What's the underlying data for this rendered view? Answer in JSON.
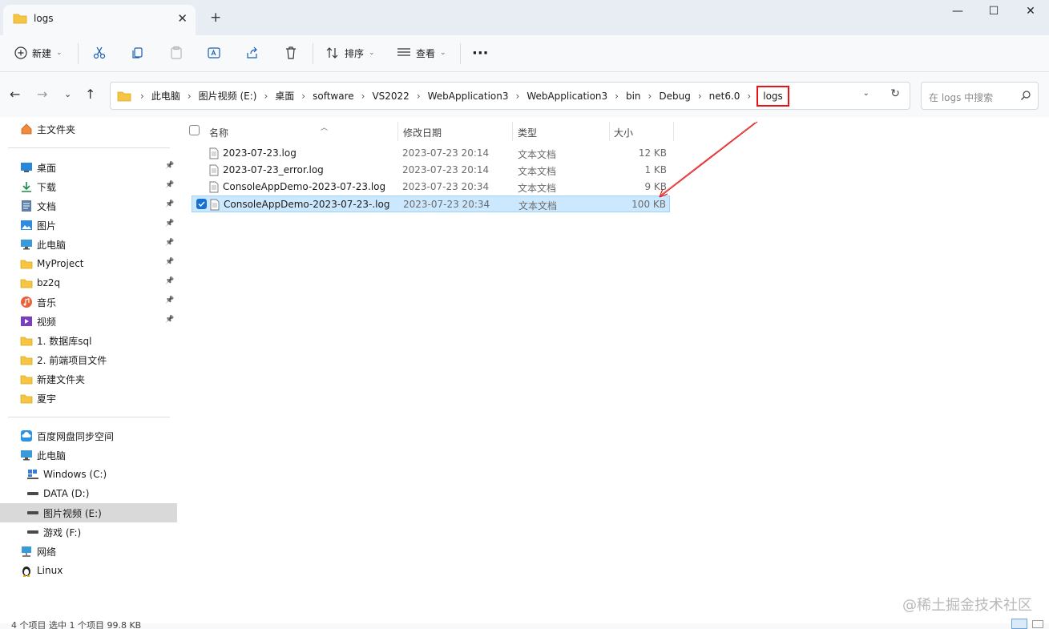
{
  "window": {
    "tab_title": "logs",
    "tab_close": "✕",
    "new_tab": "+",
    "minimize": "—",
    "maximize": "☐",
    "close": "✕"
  },
  "toolbar": {
    "new_label": "新建",
    "sort_label": "排序",
    "view_label": "查看",
    "more": "···"
  },
  "address": {
    "crumbs": [
      "此电脑",
      "图片视频 (E:)",
      "桌面",
      "software",
      "VS2022",
      "WebApplication3",
      "WebApplication3",
      "bin",
      "Debug",
      "net6.0"
    ],
    "current": "logs",
    "search_placeholder": "在 logs 中搜索"
  },
  "sidebar": {
    "home": "主文件夹",
    "quick": [
      {
        "label": "桌面",
        "icon": "desktop-icon",
        "pinned": true
      },
      {
        "label": "下载",
        "icon": "download-icon",
        "pinned": true
      },
      {
        "label": "文档",
        "icon": "document-icon",
        "pinned": true
      },
      {
        "label": "图片",
        "icon": "picture-icon",
        "pinned": true
      },
      {
        "label": "此电脑",
        "icon": "computer-icon",
        "pinned": true
      },
      {
        "label": "MyProject",
        "icon": "folder-icon",
        "pinned": true
      },
      {
        "label": "bz2q",
        "icon": "folder-icon",
        "pinned": true
      },
      {
        "label": "音乐",
        "icon": "music-icon",
        "pinned": true
      },
      {
        "label": "视频",
        "icon": "video-icon",
        "pinned": true
      },
      {
        "label": "1. 数据库sql",
        "icon": "folder-icon",
        "pinned": false
      },
      {
        "label": "2. 前端项目文件",
        "icon": "folder-icon",
        "pinned": false
      },
      {
        "label": "新建文件夹",
        "icon": "folder-icon",
        "pinned": false
      },
      {
        "label": "夏宇",
        "icon": "folder-icon",
        "pinned": false
      }
    ],
    "devices": [
      {
        "label": "百度网盘同步空间",
        "icon": "cloud-icon"
      },
      {
        "label": "此电脑",
        "icon": "computer-icon"
      },
      {
        "label": "Windows (C:)",
        "icon": "windows-drive-icon"
      },
      {
        "label": "DATA (D:)",
        "icon": "drive-icon"
      },
      {
        "label": "图片视频 (E:)",
        "icon": "drive-icon"
      },
      {
        "label": "游戏 (F:)",
        "icon": "drive-icon"
      },
      {
        "label": "网络",
        "icon": "network-icon"
      },
      {
        "label": "Linux",
        "icon": "linux-icon"
      }
    ]
  },
  "columns": {
    "name": "名称",
    "modified": "修改日期",
    "type": "类型",
    "size": "大小"
  },
  "files": [
    {
      "name": "2023-07-23.log",
      "modified": "2023-07-23 20:14",
      "type": "文本文档",
      "size": "12 KB",
      "selected": false
    },
    {
      "name": "2023-07-23_error.log",
      "modified": "2023-07-23 20:14",
      "type": "文本文档",
      "size": "1 KB",
      "selected": false
    },
    {
      "name": "ConsoleAppDemo-2023-07-23.log",
      "modified": "2023-07-23 20:34",
      "type": "文本文档",
      "size": "9 KB",
      "selected": false
    },
    {
      "name": "ConsoleAppDemo-2023-07-23-.log",
      "modified": "2023-07-23 20:34",
      "type": "文本文档",
      "size": "100 KB",
      "selected": true
    }
  ],
  "status": {
    "text": "4 个项目    选中 1 个项目  99.8 KB"
  },
  "watermark": "@稀土掘金技术社区",
  "colors": {
    "accent": "#1470d6",
    "selection": "#cce8ff",
    "annotation": "#e11111"
  }
}
